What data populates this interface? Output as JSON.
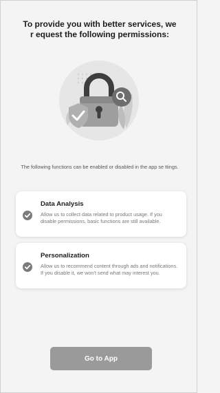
{
  "header": {
    "title": "To provide you with better services, we r equest the following permissions:"
  },
  "illustration": {
    "icon": "lock-illustration"
  },
  "description": "The following functions can be enabled or disabled in the app se ttings.",
  "permissions": [
    {
      "title": "Data Analysis",
      "text": "Allow us to collect data related to product usage. If you disable permissions, basic functions are still available.",
      "icon": "check-icon"
    },
    {
      "title": "Personalization",
      "text": "Allow us to recommend content through ads and notifications. If you disable it, we won't send what may interest you.",
      "icon": "check-icon"
    }
  ],
  "cta": {
    "label": "Go to App"
  },
  "colors": {
    "background": "#f4f4f4",
    "card": "#ffffff",
    "check": "#7b7b7b",
    "button": "#9a9a9a"
  }
}
